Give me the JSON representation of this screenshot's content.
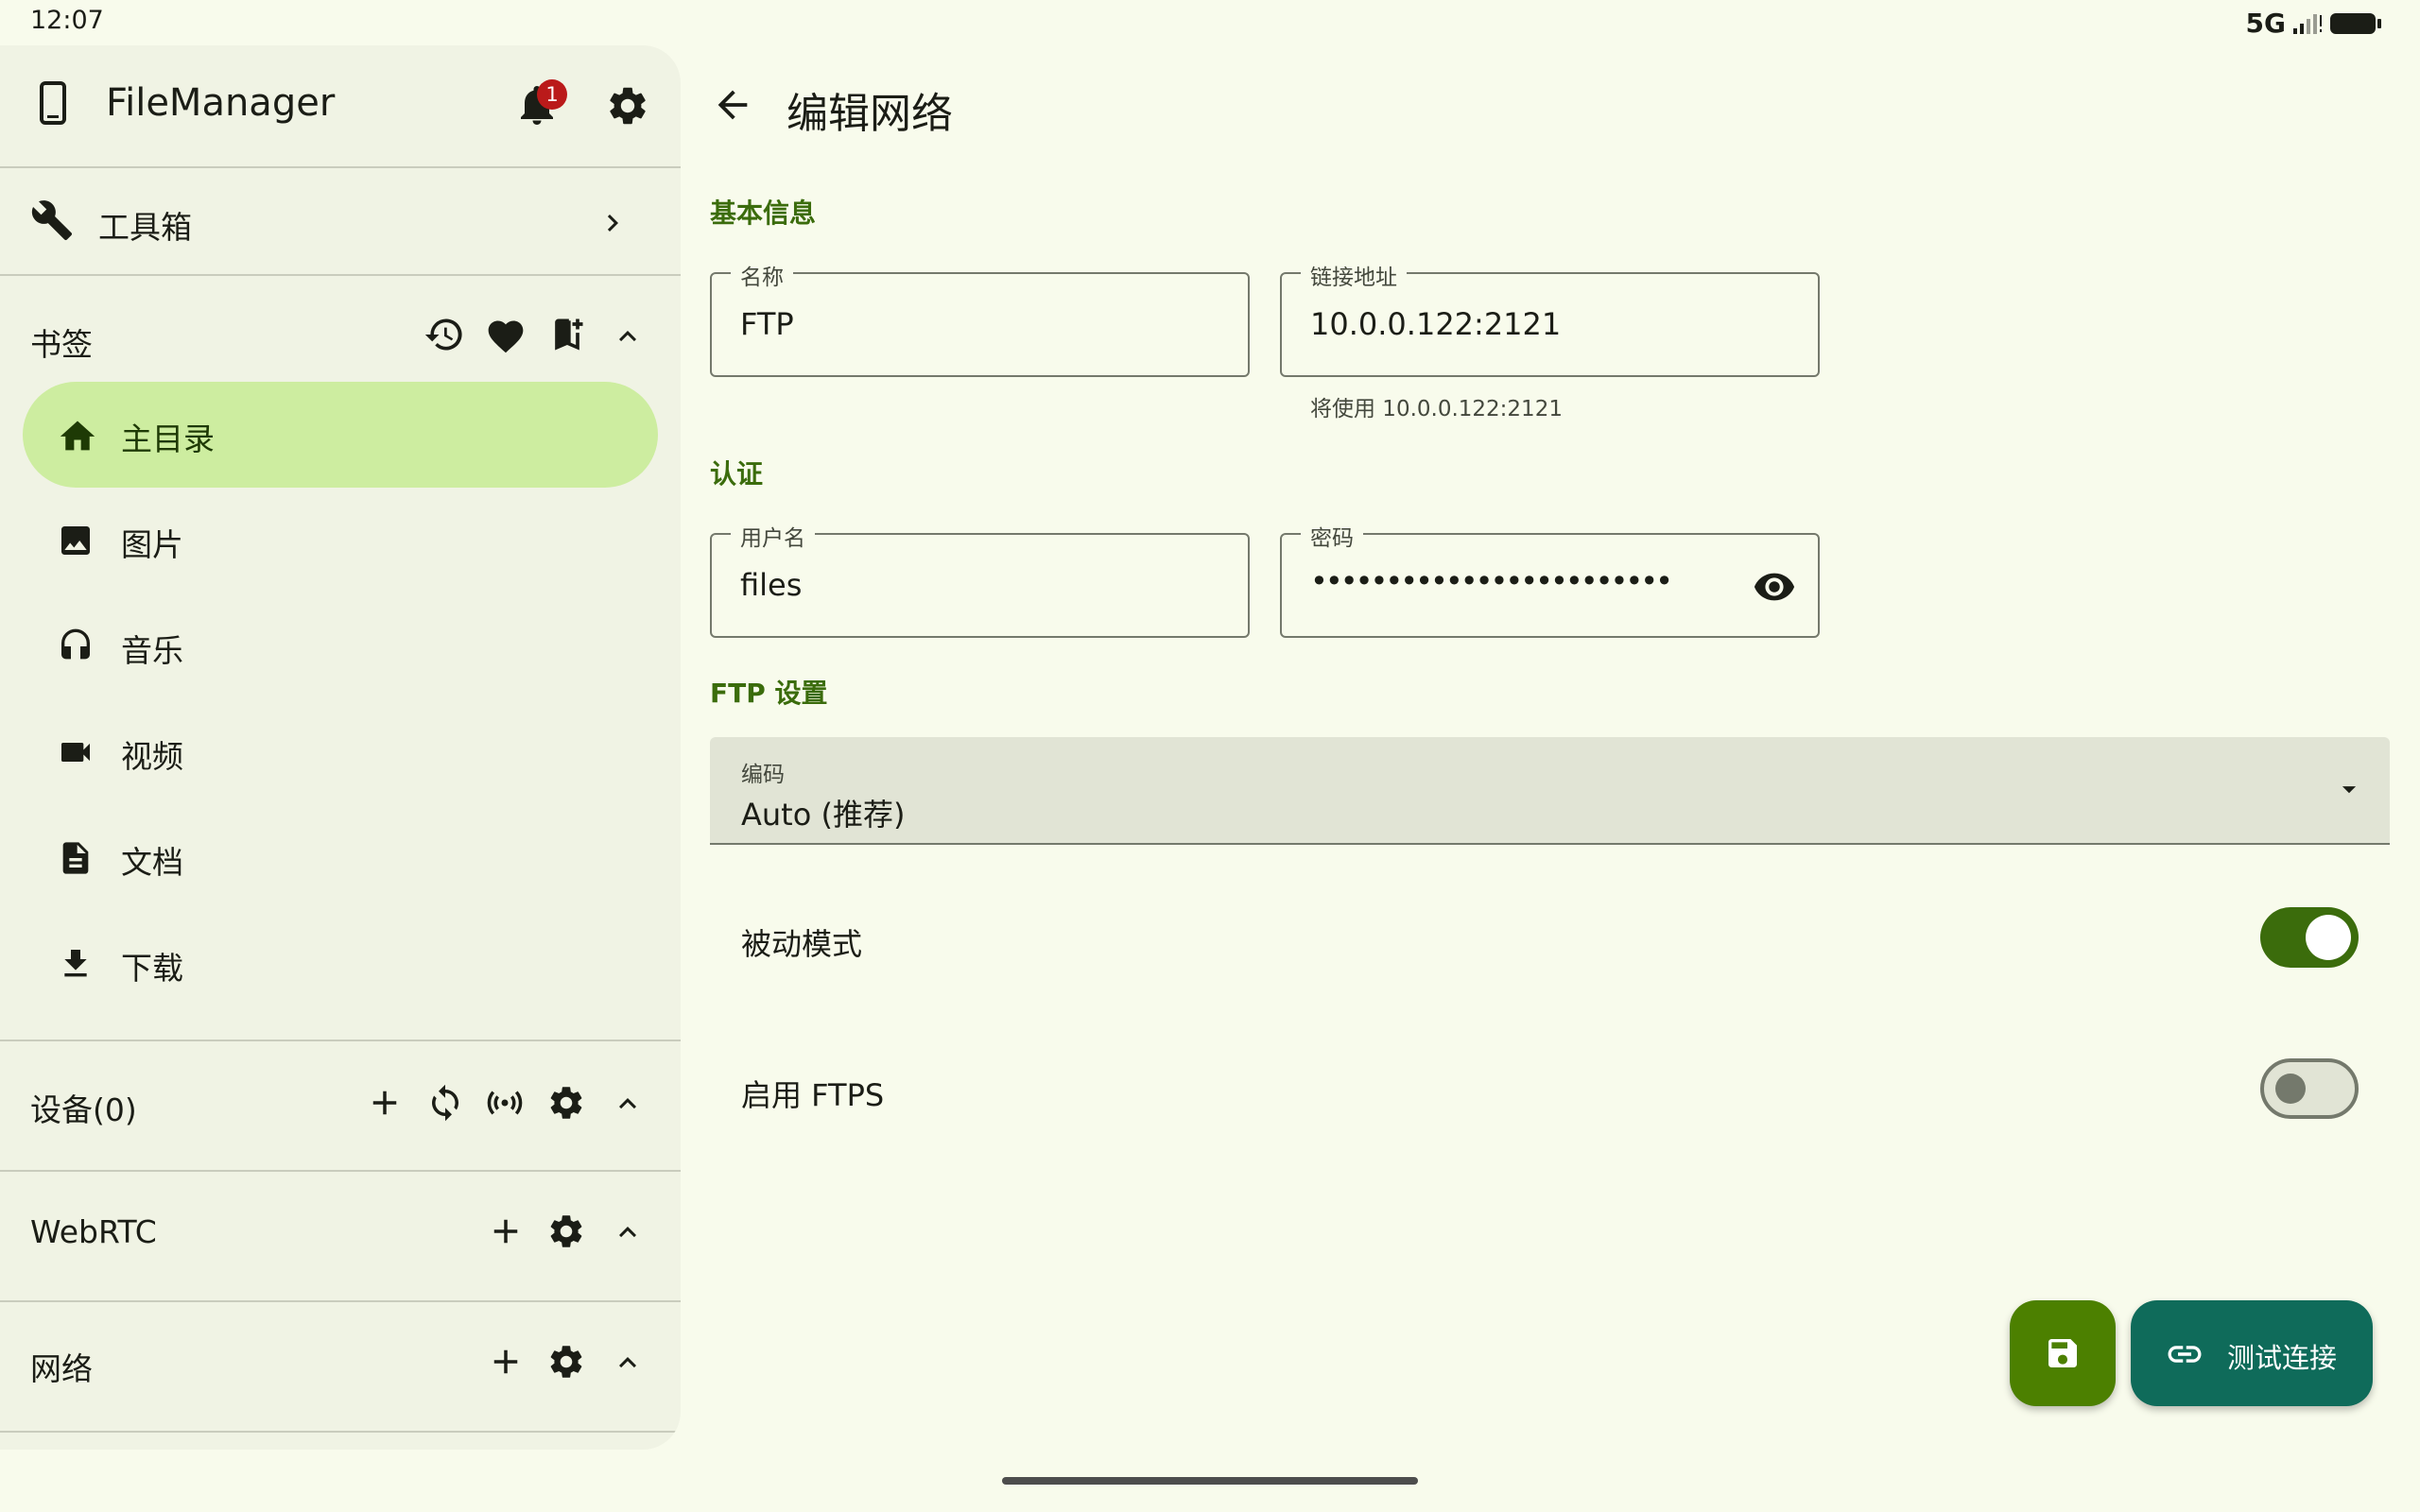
{
  "status_bar": {
    "time": "12:07",
    "network": "5G"
  },
  "drawer": {
    "app_title": "FileManager",
    "notification_count": "1",
    "toolbox_label": "工具箱",
    "bookmarks": {
      "title": "书签",
      "items": [
        {
          "label": "主目录",
          "icon": "home-icon",
          "selected": true
        },
        {
          "label": "图片",
          "icon": "image-icon"
        },
        {
          "label": "音乐",
          "icon": "headphones-icon"
        },
        {
          "label": "视频",
          "icon": "videocam-icon"
        },
        {
          "label": "文档",
          "icon": "document-icon"
        },
        {
          "label": "下载",
          "icon": "download-icon"
        }
      ]
    },
    "devices_title": "设备(0)",
    "webrtc_title": "WebRTC",
    "network_title": "网络"
  },
  "main": {
    "title": "编辑网络",
    "basic_section": "基本信息",
    "name_field": {
      "label": "名称",
      "value": "FTP"
    },
    "address_field": {
      "label": "链接地址",
      "value": "10.0.0.122:2121",
      "helper": "将使用 10.0.0.122:2121"
    },
    "auth_section": "认证",
    "username_field": {
      "label": "用户名",
      "value": "files"
    },
    "password_field": {
      "label": "密码",
      "value": "••••••••••••••••••••••••"
    },
    "ftp_section": "FTP 设置",
    "encoding_field": {
      "label": "编码",
      "value": "Auto (推荐)"
    },
    "passive_mode": {
      "label": "被动模式",
      "enabled": true
    },
    "ftps": {
      "label": "启用 FTPS",
      "enabled": false
    },
    "test_button": "测试连接"
  },
  "colors": {
    "accent": "#3b6c0c",
    "selected_nav": "#cdeda0",
    "save_fab": "#4c8000",
    "test_fab": "#0f6b5a",
    "badge": "#ba1a1a"
  }
}
